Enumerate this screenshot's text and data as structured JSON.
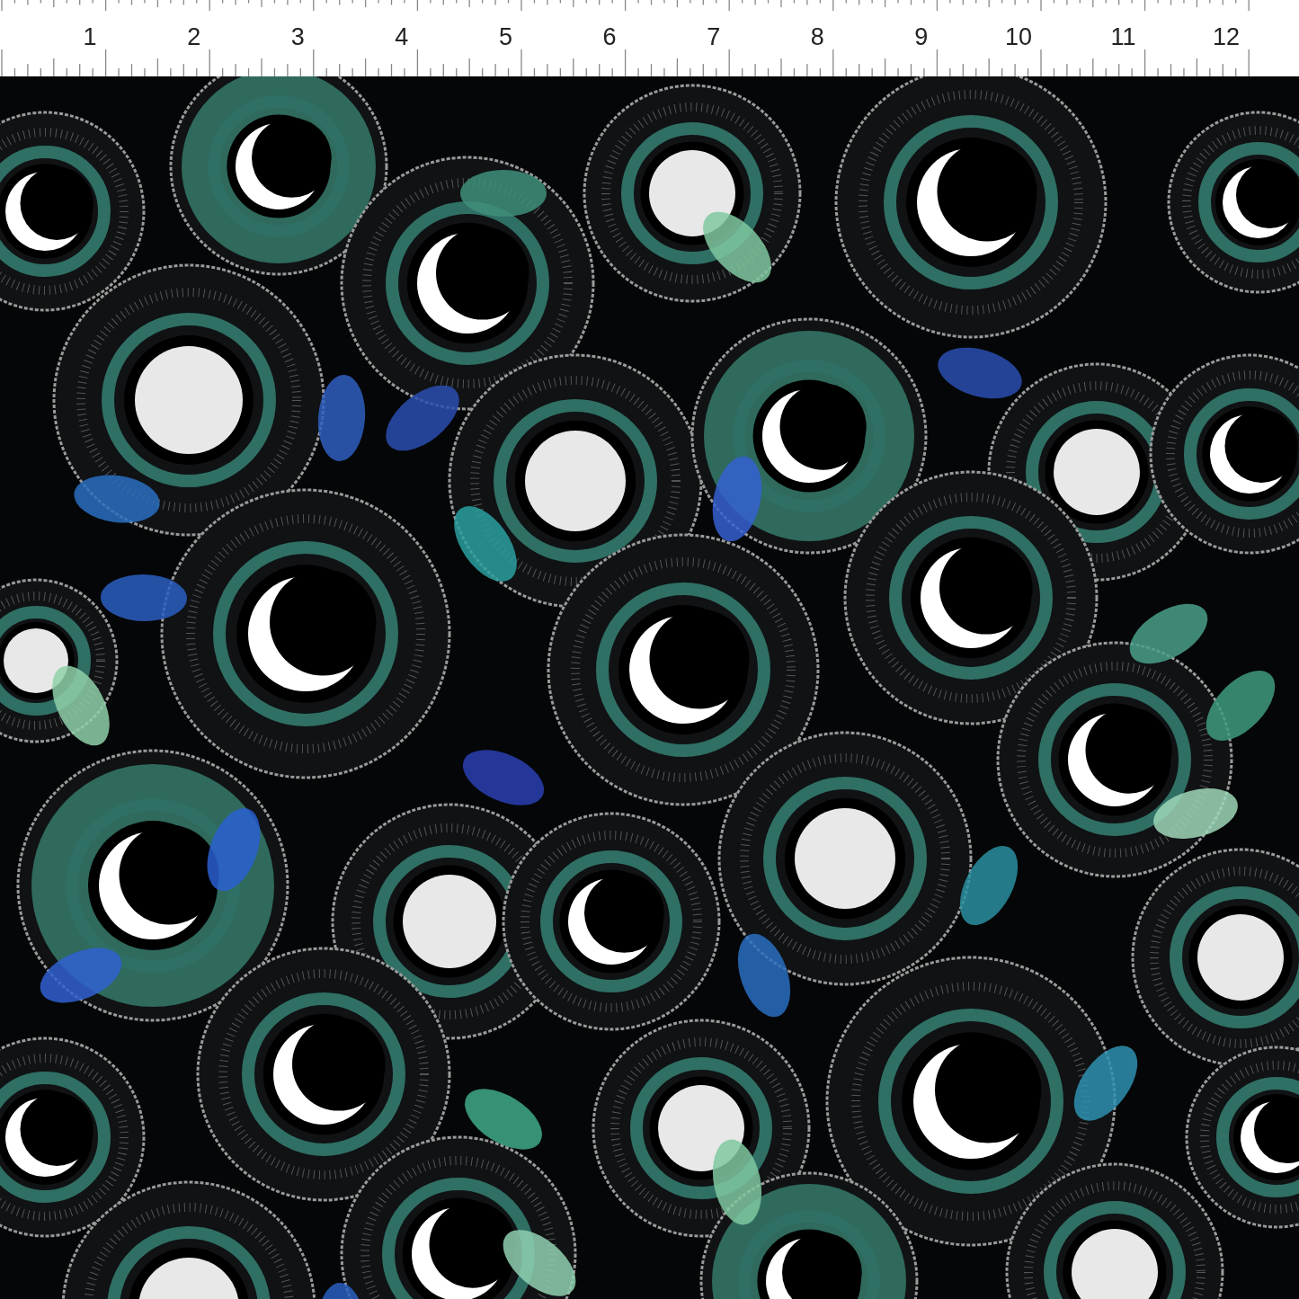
{
  "ruler": {
    "labels": [
      "1",
      "2",
      "3",
      "4",
      "5",
      "6",
      "7",
      "8",
      "9",
      "10",
      "11",
      "12"
    ]
  }
}
